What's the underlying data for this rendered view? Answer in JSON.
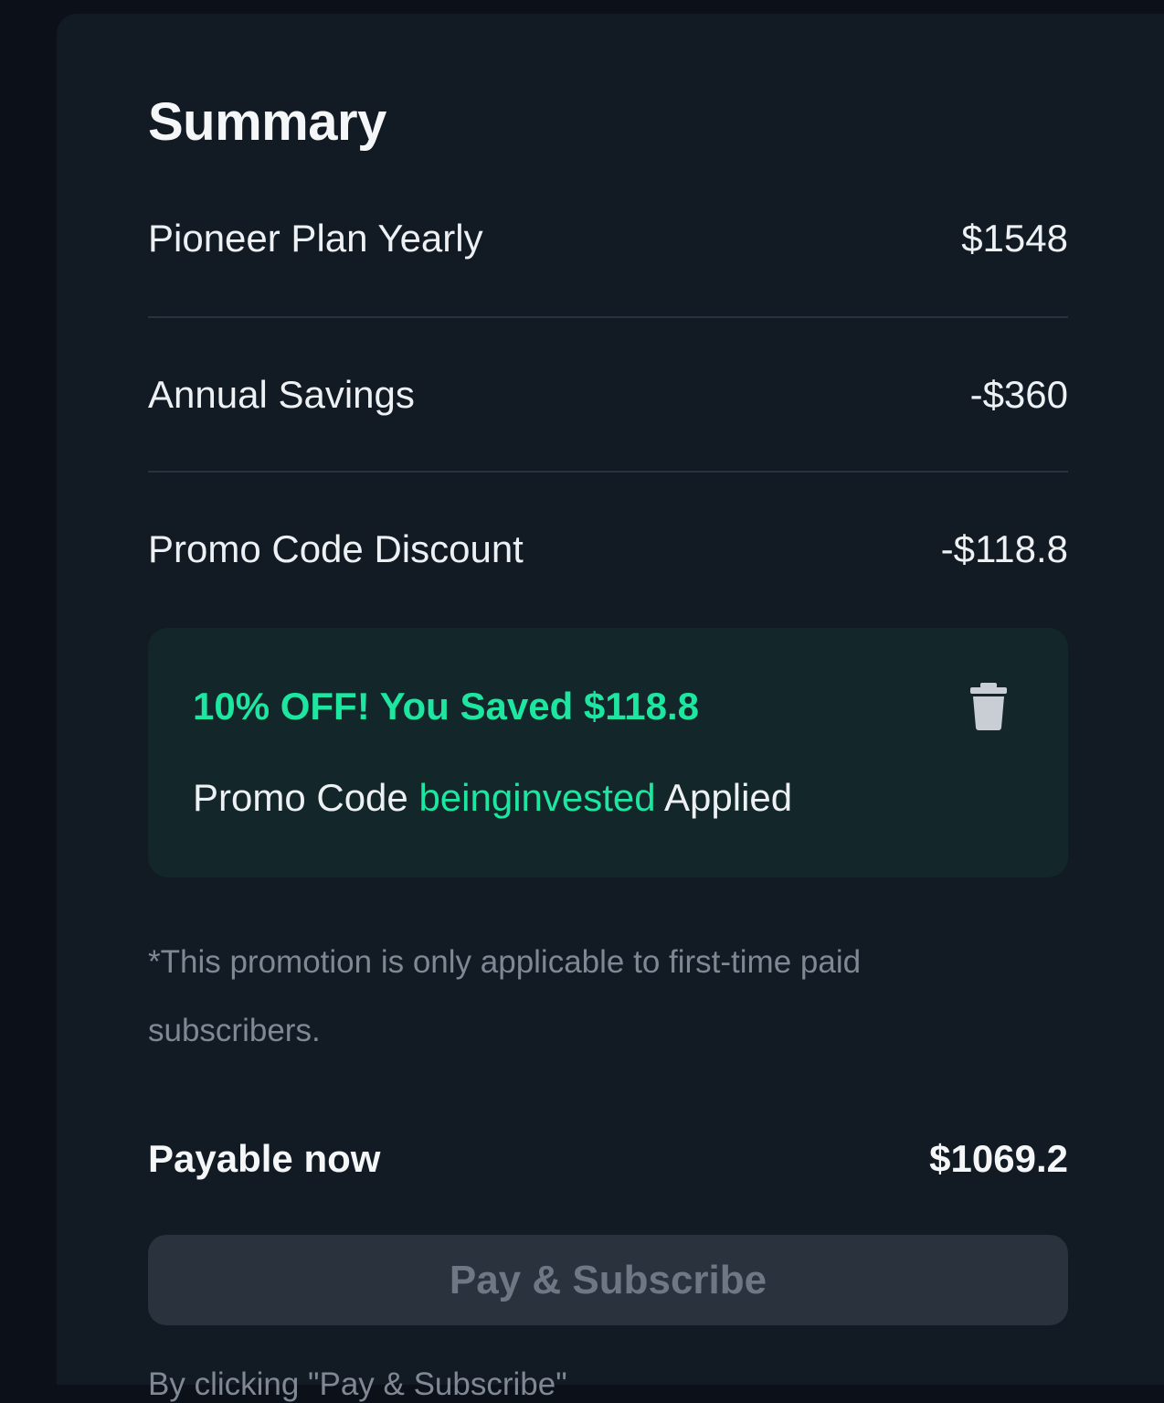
{
  "summary": {
    "title": "Summary",
    "items": [
      {
        "label": "Pioneer Plan Yearly",
        "amount": "$1548"
      },
      {
        "label": "Annual Savings",
        "amount": "-$360"
      },
      {
        "label": "Promo Code Discount",
        "amount": "-$118.8"
      }
    ],
    "promo": {
      "headline": "10% OFF! You Saved $118.8",
      "applied_prefix": "Promo Code ",
      "code": "beinginvested",
      "applied_suffix": " Applied",
      "remove_icon": "trash-icon"
    },
    "note": "*This promotion is only applicable to first-time paid subscribers.",
    "payable_label": "Payable now",
    "payable_amount": "$1069.2",
    "pay_button_label": "Pay & Subscribe",
    "footer_text": "By clicking \"Pay & Subscribe\""
  },
  "colors": {
    "accent": "#1de6a0",
    "panel": "#121a24",
    "page": "#0b1019",
    "promo_box": "#13262a",
    "button_disabled": "#29323d"
  }
}
